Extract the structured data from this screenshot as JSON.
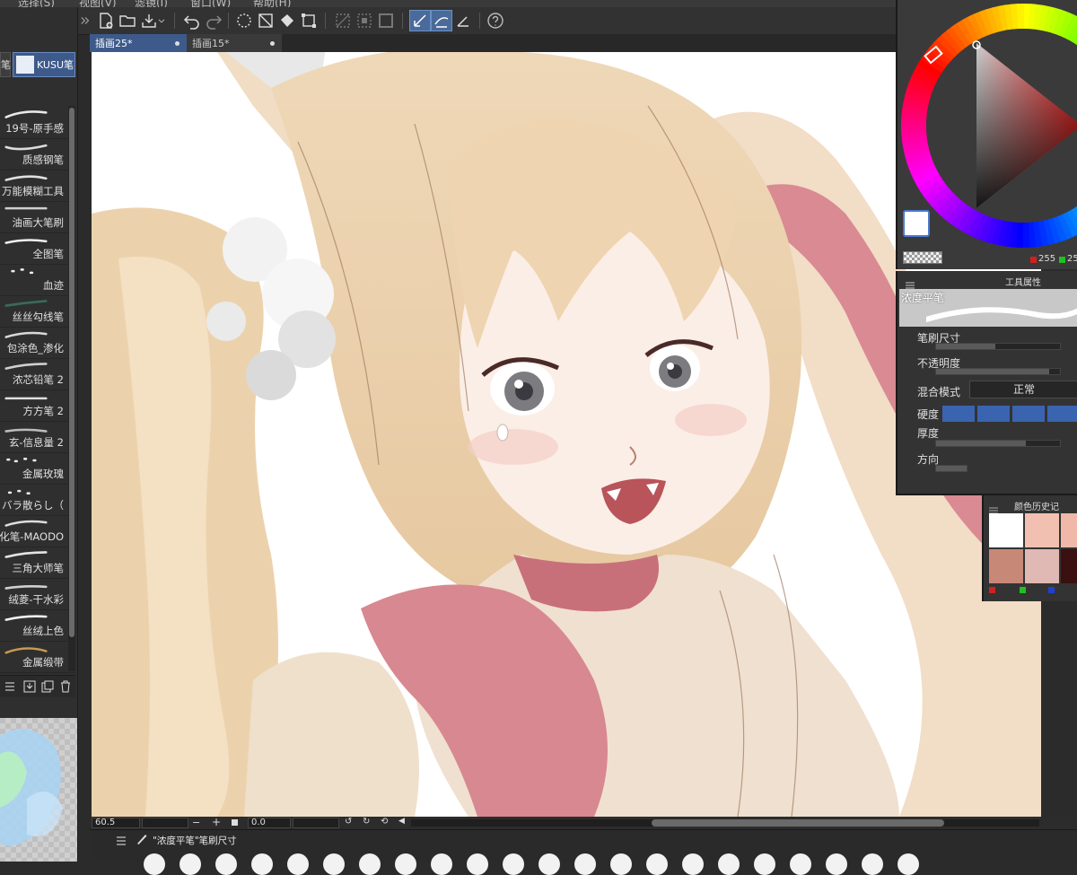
{
  "menubar": {
    "items": [
      "选择(S)",
      "视图(V)",
      "滤镜(I)",
      "窗口(W)",
      "帮助(H)"
    ]
  },
  "left_panel": {
    "sub_tool_tab": "KUSU笔",
    "sub_tool_partial": "笔",
    "brushes": [
      {
        "label": "19号-原手感"
      },
      {
        "label": "质感钢笔"
      },
      {
        "label": "万能模糊工具"
      },
      {
        "label": "油画大笔刷"
      },
      {
        "label": "全图笔"
      },
      {
        "label": "血迹"
      },
      {
        "label": "丝丝勾线笔"
      },
      {
        "label": "包涂色_渗化"
      },
      {
        "label": "浓芯铅笔 2"
      },
      {
        "label": "方方笔 2"
      },
      {
        "label": "玄-信息量 2"
      },
      {
        "label": "金属玫瑰"
      },
      {
        "label": "バラ散らし（"
      },
      {
        "label": "细化笔-MAODO"
      },
      {
        "label": "三角大师笔"
      },
      {
        "label": "绒菱-干水彩"
      },
      {
        "label": "丝绒上色"
      },
      {
        "label": "金属缎带"
      }
    ]
  },
  "tabs": [
    {
      "label": "插画25*",
      "active": true
    },
    {
      "label": "插画15*",
      "active": false
    }
  ],
  "statusbar": {
    "zoom": "60.5",
    "angle": "0.0"
  },
  "bottom_bar": {
    "brush_size_label": "\"浓度平笔\"笔刷尺寸"
  },
  "color_panel": {
    "r_value": "255",
    "g_value": "25"
  },
  "tool_property": {
    "title": "工具属性",
    "brush_name": "浓度平笔",
    "brush_size_label": "笔刷尺寸",
    "opacity_label": "不透明度",
    "blend_mode_label": "混合模式",
    "blend_mode_value": "正常",
    "hardness_label": "硬度",
    "thickness_label": "厚度",
    "direction_label": "方向"
  },
  "color_history": {
    "title": "颜色历史记",
    "swatches": [
      "#ffffff",
      "#f2c0b0",
      "#f0b8a8",
      "#c88878",
      "#e0b8b4",
      "#3a1010"
    ]
  },
  "colors": {
    "accent": "#4a6a9a",
    "panel": "#333333",
    "canvas": "#ffffff"
  }
}
